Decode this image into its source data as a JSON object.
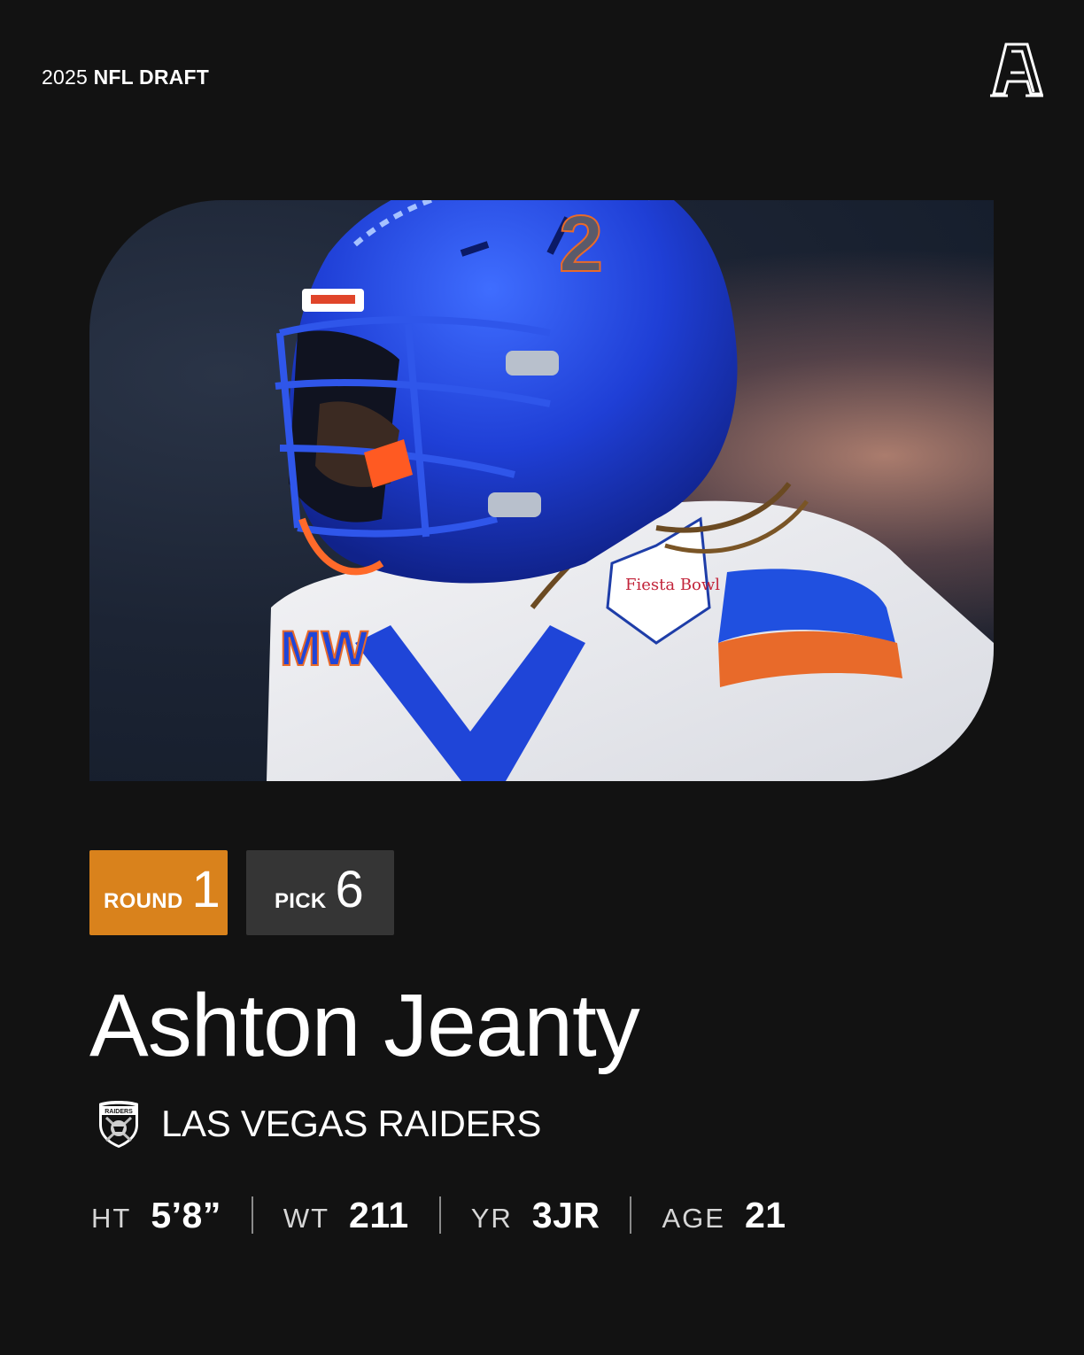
{
  "header": {
    "year": "2025",
    "event": "NFL DRAFT"
  },
  "brand": {
    "logo_icon": "the-athletic-a-logo",
    "logo_letter": "A"
  },
  "photo": {
    "icon": "player-helmet-photo",
    "helmet_number": "2",
    "patch_text": "Fiesta Bowl",
    "sleeve_text": "MW"
  },
  "badges": {
    "round_label": "ROUND",
    "round_value": "1",
    "pick_label": "PICK",
    "pick_value": "6",
    "round_color": "#d9821c",
    "pick_color": "#353535"
  },
  "player": {
    "name": "Ashton Jeanty"
  },
  "team": {
    "logo_icon": "raiders-shield-icon",
    "logo_text": "RAIDERS",
    "name": "LAS VEGAS RAIDERS"
  },
  "stats": [
    {
      "label": "HT",
      "value": "5’8”"
    },
    {
      "label": "WT",
      "value": "211"
    },
    {
      "label": "YR",
      "value": "3JR"
    },
    {
      "label": "AGE",
      "value": "21"
    }
  ]
}
